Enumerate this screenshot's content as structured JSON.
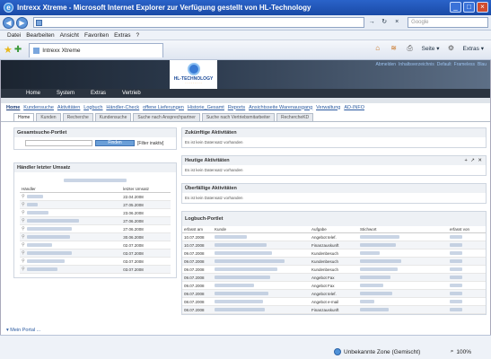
{
  "window": {
    "title": "Intrexx Xtreme - Microsoft Internet Explorer  zur Verfügung gestellt von HL-Technology",
    "ie_logo": "e",
    "minimize": "_",
    "maximize": "□",
    "close": "×"
  },
  "address": {
    "url": "",
    "search_placeholder": "Google",
    "go": "→",
    "refresh": "↻",
    "stop": "×"
  },
  "menu": [
    "Datei",
    "Bearbeiten",
    "Ansicht",
    "Favoriten",
    "Extras",
    "?"
  ],
  "favbar": {
    "tab_title": "Intrexx Xtreme",
    "seite": "Seite ▾",
    "extras": "Extras ▾"
  },
  "banner": {
    "logo_text": "HL-TECHNOLOGY",
    "logo_sub": "· · · · · · · · ·",
    "toplinks": [
      "Abmelden",
      "Inhaltsverzeichnis",
      "Default",
      "Frameless",
      "Blau"
    ]
  },
  "mainnav": [
    "Home",
    "System",
    "Extras",
    "Vertrieb"
  ],
  "submenu": [
    "Home",
    "Kundensuche",
    "Aktivitäten",
    "Logbuch",
    "Händler-Check",
    "offene Lieferungen",
    "Historie_Gesamt",
    "Reports",
    "Ansichtsseite Warenausgang",
    "Verwaltung",
    "AD-INFO"
  ],
  "portal_tabs": [
    "Home",
    "Kunden",
    "Recherche",
    "Kundensuche",
    "Suche nach Ansprechpartner",
    "Suche nach Vertriebsmitarbeiter",
    "RechercheKD"
  ],
  "gesamtsuche": {
    "title": "Gesamtsuche-Portlet",
    "button": "Finden",
    "filter": "[Filter inaktiv]"
  },
  "haendler": {
    "title": "Händler letzter Umsatz",
    "col_name": "Händler",
    "col_date": "letzter Umsatz",
    "dates": [
      "22.04.2008",
      "27.05.2008",
      "23.06.2008",
      "27.06.2008",
      "27.06.2008",
      "30.06.2008",
      "02.07.2008",
      "03.07.2008",
      "03.07.2008",
      "03.07.2008"
    ]
  },
  "zukuenftig": {
    "title": "Zukünftige Aktivitäten",
    "empty": "Es ist kein Datensatz vorhanden"
  },
  "heutig": {
    "title": "Heutige Aktivitäten",
    "tools": "+ ↗ ✕",
    "empty": "Es ist kein Datensatz vorhanden"
  },
  "ueberfaellig": {
    "title": "Überfällige Aktivitäten",
    "empty": "Es ist kein Datensatz vorhanden"
  },
  "logbuch": {
    "title": "Logbuch-Portlet",
    "columns": [
      "erfasst am",
      "Kunde",
      "Aufgabe",
      "Stichwort",
      "erfasst von"
    ],
    "rows": [
      {
        "date": "10.07.2008",
        "task": "Angebot telef."
      },
      {
        "date": "10.07.2008",
        "task": "Finanzauskunft"
      },
      {
        "date": "09.07.2008",
        "task": "Kundenbesuch"
      },
      {
        "date": "09.07.2008",
        "task": "Kundenbesuch"
      },
      {
        "date": "09.07.2008",
        "task": "Kundenbesuch"
      },
      {
        "date": "09.07.2008",
        "task": "Angebot Fax"
      },
      {
        "date": "09.07.2008",
        "task": "Angebot Fax"
      },
      {
        "date": "09.07.2008",
        "task": "Angebot telef."
      },
      {
        "date": "08.07.2008",
        "task": "Angebot e-mail"
      },
      {
        "date": "08.07.2008",
        "task": "Finanzauskunft"
      }
    ]
  },
  "footer": {
    "myportal": "▾ Mein Portal ..."
  },
  "status": {
    "zone": "Unbekannte Zone (Gemischt)",
    "zoom": "100%"
  }
}
